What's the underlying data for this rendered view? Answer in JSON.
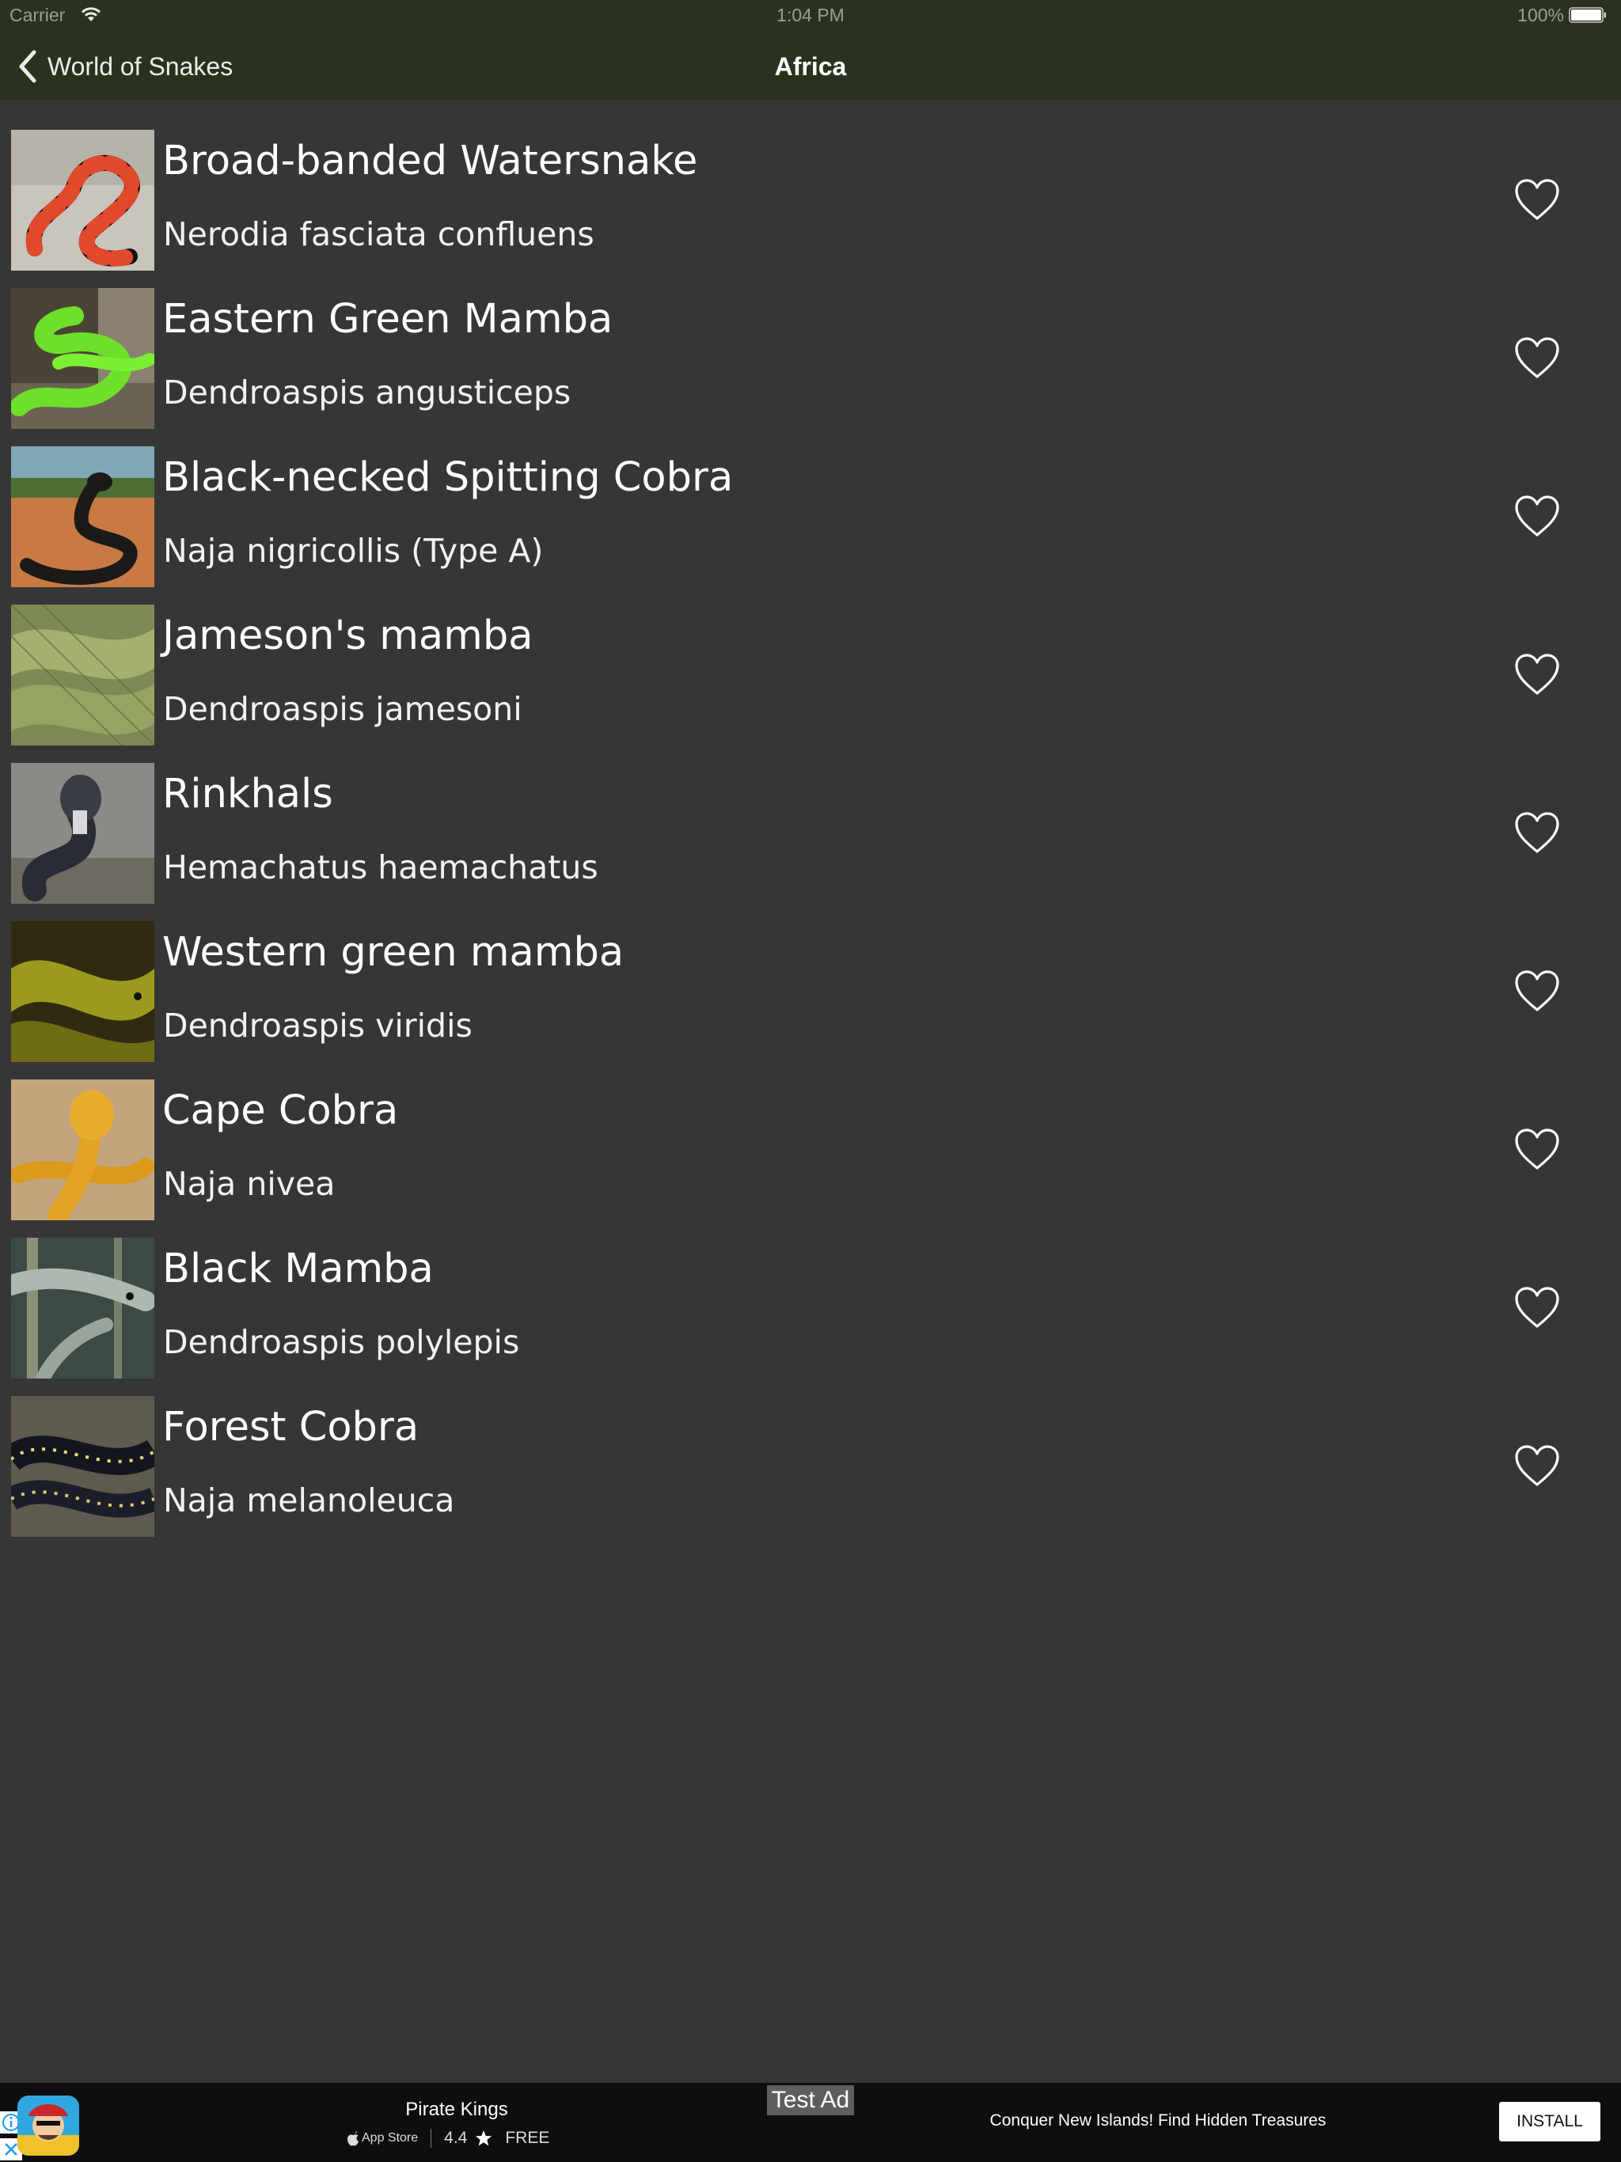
{
  "status_bar": {
    "carrier": "Carrier",
    "time": "1:04 PM",
    "battery": "100%",
    "icons": [
      "wifi-icon",
      "battery-icon"
    ]
  },
  "nav": {
    "back_label": "World of Snakes",
    "title": "Africa",
    "bar_color": "#2a321f"
  },
  "snakes": [
    {
      "name": "Broad-banded Watersnake",
      "scientific": "Nerodia fasciata confluens",
      "favorite": false
    },
    {
      "name": "Eastern Green Mamba",
      "scientific": "Dendroaspis angusticeps",
      "favorite": false
    },
    {
      "name": "Black-necked Spitting Cobra",
      "scientific": "Naja nigricollis (Type A)",
      "favorite": false
    },
    {
      "name": "Jameson's mamba",
      "scientific": "Dendroaspis jamesoni",
      "favorite": false
    },
    {
      "name": "Rinkhals",
      "scientific": "Hemachatus haemachatus",
      "favorite": false
    },
    {
      "name": "Western green mamba",
      "scientific": "Dendroaspis viridis",
      "favorite": false
    },
    {
      "name": "Cape Cobra",
      "scientific": "Naja nivea",
      "favorite": false
    },
    {
      "name": "Black Mamba",
      "scientific": "Dendroaspis polylepis",
      "favorite": false
    },
    {
      "name": "Forest Cobra",
      "scientific": "Naja melanoleuca",
      "favorite": false
    }
  ],
  "ad": {
    "app_name": "Pirate Kings",
    "store": "App Store",
    "rating": "4.4",
    "price": "FREE",
    "test_label": "Test Ad",
    "tagline": "Conquer New Islands! Find Hidden Treasures",
    "install_label": "INSTALL"
  },
  "colors": {
    "background": "#363636",
    "ad_background": "#0e0e0e"
  }
}
